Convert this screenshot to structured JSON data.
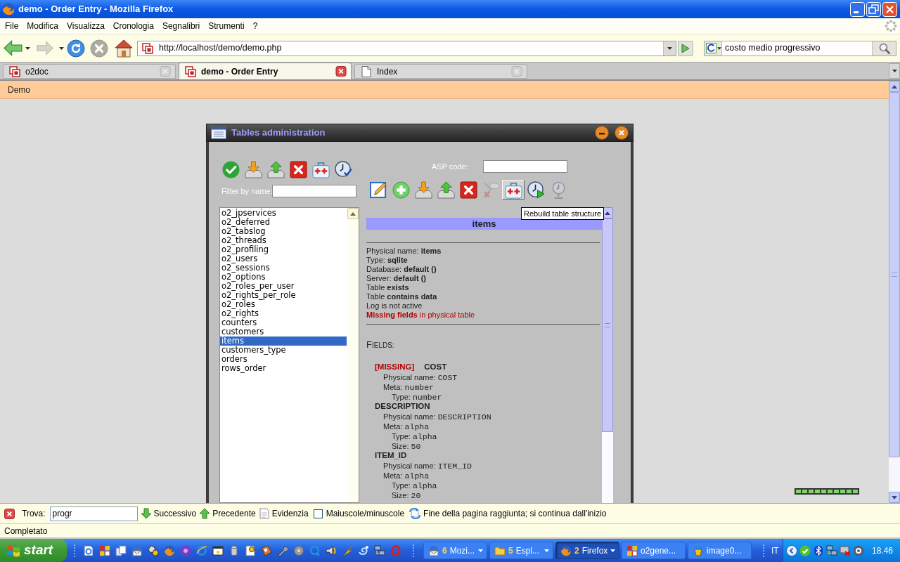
{
  "window": {
    "title": "demo - Order Entry - Mozilla Firefox"
  },
  "menu": [
    "File",
    "Modifica",
    "Visualizza",
    "Cronologia",
    "Segnalibri",
    "Strumenti",
    "?"
  ],
  "toolbar": {
    "buttons": [
      {
        "kind": "back",
        "disabled": false
      },
      {
        "kind": "forward",
        "disabled": true
      },
      {
        "kind": "reload",
        "disabled": false
      },
      {
        "kind": "stop",
        "disabled": true
      },
      {
        "kind": "home",
        "disabled": false
      }
    ],
    "url": "http://localhost/demo/demo.php",
    "search": "costo medio progressivo"
  },
  "tabs": [
    {
      "label": "o2doc",
      "kind": "app",
      "selected": false
    },
    {
      "label": "demo - Order Entry",
      "kind": "app",
      "selected": true
    },
    {
      "label": "Index",
      "kind": "page",
      "selected": false
    }
  ],
  "page": {
    "header": "Demo",
    "meter": {
      "level": 1
    }
  },
  "dialog": {
    "title": "Tables administration",
    "left_tools": [
      {
        "kind": "accept",
        "disabled": false
      },
      {
        "kind": "import",
        "disabled": false
      },
      {
        "kind": "export",
        "disabled": false
      },
      {
        "kind": "delete",
        "disabled": false
      },
      {
        "kind": "rebuild",
        "disabled": false
      },
      {
        "kind": "schedule",
        "disabled": false
      }
    ],
    "filter": {
      "label": "Filter by name:"
    },
    "asp_code": {
      "label": "ASP code:"
    },
    "right_tools": [
      {
        "kind": "edit",
        "disabled": false,
        "pressed": false
      },
      {
        "kind": "add",
        "disabled": false,
        "pressed": false
      },
      {
        "kind": "import",
        "disabled": false,
        "pressed": false
      },
      {
        "kind": "export",
        "disabled": false,
        "pressed": false
      },
      {
        "kind": "delete",
        "disabled": false,
        "pressed": false
      },
      {
        "kind": "unlink",
        "disabled": true,
        "pressed": false
      },
      {
        "kind": "rebuild",
        "disabled": false,
        "pressed": true
      },
      {
        "kind": "run",
        "disabled": false,
        "pressed": false
      },
      {
        "kind": "alarm",
        "disabled": true,
        "pressed": false
      }
    ],
    "tooltip": "Rebuild table structure",
    "tables": [
      {
        "name": "o2_jpservices",
        "selected": false
      },
      {
        "name": "o2_deferred",
        "selected": false
      },
      {
        "name": "o2_tabslog",
        "selected": false
      },
      {
        "name": "o2_threads",
        "selected": false
      },
      {
        "name": "o2_profiling",
        "selected": false
      },
      {
        "name": "o2_users",
        "selected": false
      },
      {
        "name": "o2_sessions",
        "selected": false
      },
      {
        "name": "o2_options",
        "selected": false
      },
      {
        "name": "o2_roles_per_user",
        "selected": false
      },
      {
        "name": "o2_rights_per_role",
        "selected": false
      },
      {
        "name": "o2_roles",
        "selected": false
      },
      {
        "name": "o2_rights",
        "selected": false
      },
      {
        "name": "counters",
        "selected": false
      },
      {
        "name": "customers",
        "selected": false
      },
      {
        "name": "items",
        "selected": true
      },
      {
        "name": "customers_type",
        "selected": false
      },
      {
        "name": "orders",
        "selected": false
      },
      {
        "name": "rows_order",
        "selected": false
      }
    ],
    "details": {
      "title": "items",
      "properties": [
        {
          "text": "Physical name: **items**",
          "kind": "info"
        },
        {
          "text": "Type: **sqlite**",
          "kind": "info"
        },
        {
          "text": "Database: **default ()**",
          "kind": "info"
        },
        {
          "text": "Server: **default ()**",
          "kind": "info"
        },
        {
          "text": "Table **exists**",
          "kind": "info"
        },
        {
          "text": "Table **contains data**",
          "kind": "info"
        },
        {
          "text": "Log is not active",
          "kind": "info"
        },
        {
          "text": "**Missing fields** in physical table",
          "kind": "error"
        }
      ],
      "fields_heading": "FIELDS:",
      "fields": [
        {
          "name": "COST",
          "tag": "[MISSING]",
          "properties": [
            {
              "label": "Physical name:",
              "value": "COST"
            },
            {
              "label": "Meta:",
              "value": "number",
              "children": [
                {
                  "label": "Type:",
                  "value": "number"
                }
              ]
            }
          ]
        },
        {
          "name": "DESCRIPTION",
          "properties": [
            {
              "label": "Physical name:",
              "value": "DESCRIPTION"
            },
            {
              "label": "Meta:",
              "value": "alpha",
              "children": [
                {
                  "label": "Type:",
                  "value": "alpha"
                },
                {
                  "label": "Size:",
                  "value": "50"
                }
              ]
            }
          ]
        },
        {
          "name": "ITEM_ID",
          "properties": [
            {
              "label": "Physical name:",
              "value": "ITEM_ID"
            },
            {
              "label": "Meta:",
              "value": "alpha",
              "children": [
                {
                  "label": "Type:",
                  "value": "alpha"
                },
                {
                  "label": "Size:",
                  "value": "20"
                }
              ]
            }
          ]
        }
      ]
    }
  },
  "find_bar": {
    "label": "Trova:",
    "value": "progr",
    "buttons": [
      {
        "kind": "next",
        "label": "Successivo"
      },
      {
        "kind": "previous",
        "label": "Precedente"
      },
      {
        "kind": "highlight",
        "label": "Evidenzia"
      }
    ],
    "match_case": {
      "label": "Maiuscole/minuscole",
      "checked": false
    },
    "message": "Fine della pagina raggiunta; si continua dall'inizio"
  },
  "status_bar": {
    "text": "Completato"
  },
  "taskbar": {
    "start": "start",
    "tasks": [
      {
        "count": "6",
        "label": "Mozi...",
        "kind": "mail",
        "grouped": true,
        "selected": false
      },
      {
        "count": "5",
        "label": "Espl...",
        "kind": "folder",
        "grouped": true,
        "selected": false
      },
      {
        "count": "2",
        "label": "Firefox",
        "kind": "browser",
        "grouped": true,
        "selected": true
      },
      {
        "label": "o2gene...",
        "kind": "tiles",
        "grouped": false,
        "selected": false
      },
      {
        "label": "image0...",
        "kind": "paint",
        "grouped": false,
        "selected": false
      }
    ],
    "language": "IT",
    "clock": "18.46"
  }
}
